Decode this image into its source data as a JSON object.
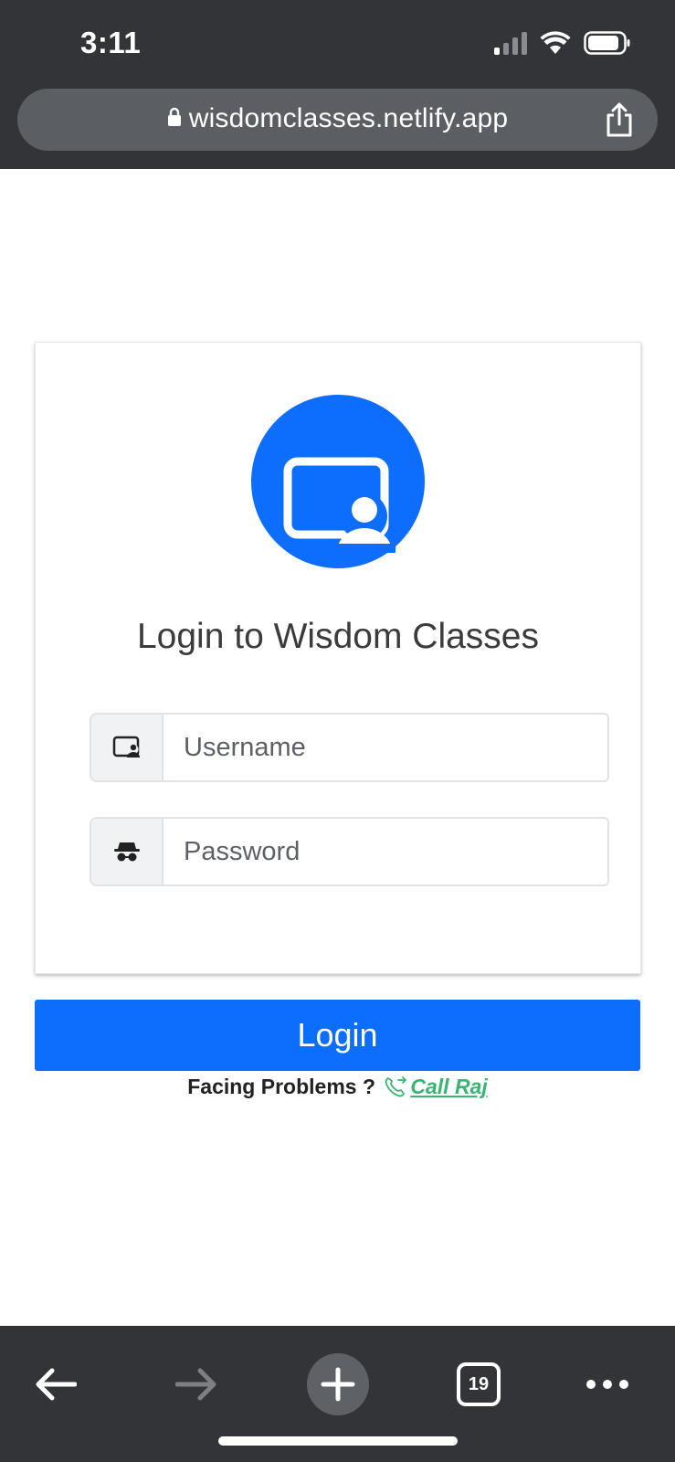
{
  "status_bar": {
    "time": "3:11",
    "icons": [
      "signal-icon",
      "wifi-icon",
      "battery-icon"
    ]
  },
  "browser": {
    "url": "wisdomclasses.netlify.app"
  },
  "login_card": {
    "title": "Login to Wisdom Classes",
    "username_placeholder": "Username",
    "password_placeholder": "Password",
    "logo_icon": "classroom-person-icon",
    "username_icon": "id-card-icon",
    "password_icon": "incognito-icon"
  },
  "login_button": {
    "label": "Login"
  },
  "help": {
    "text": "Facing Problems ?",
    "link_label": "Call Raj",
    "link_icon": "phone-forward-icon"
  },
  "toolbar": {
    "tab_count": "19",
    "icons": [
      "back-arrow-icon",
      "forward-arrow-icon",
      "new-tab-plus-icon",
      "tabs-icon",
      "more-icon"
    ]
  },
  "colors": {
    "accent": "#0d6efd",
    "link": "#3cb371",
    "chrome": "#323437"
  }
}
